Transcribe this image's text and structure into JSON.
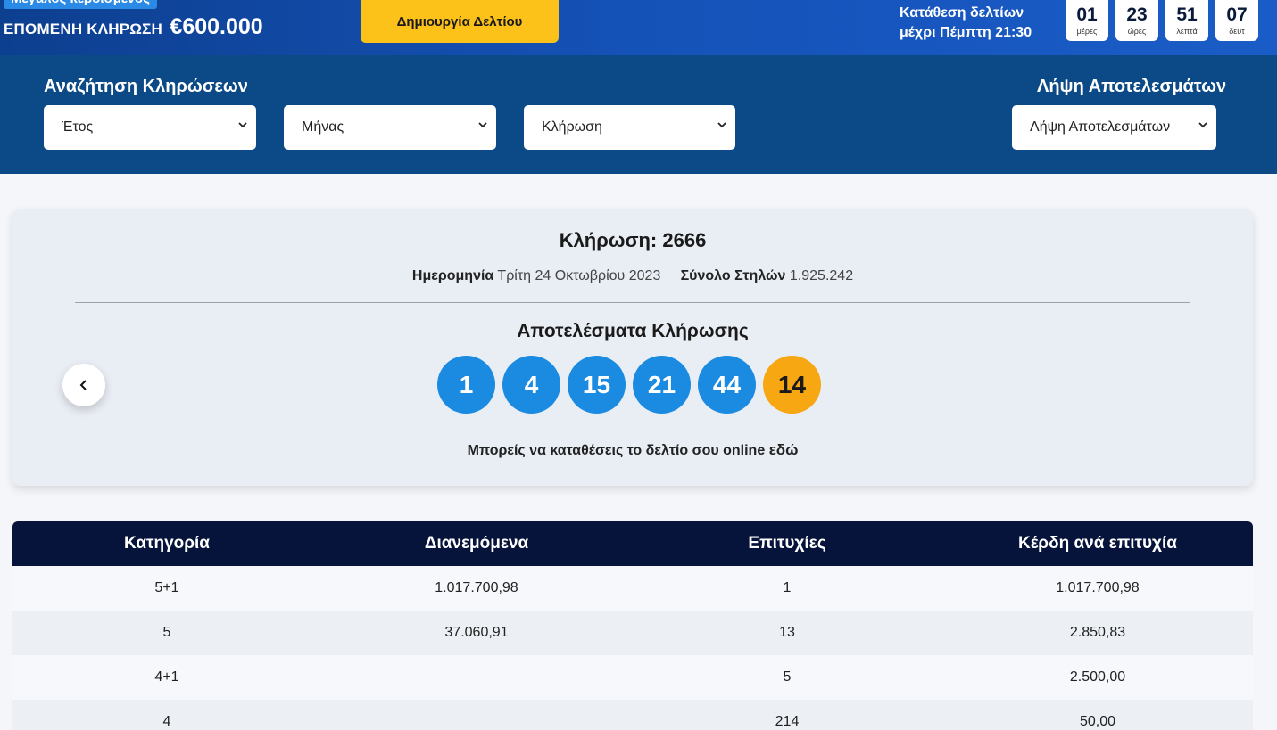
{
  "header": {
    "promo_tag": "Μεγάλος κερδισμένος",
    "next_draw_label": "ΕΠΟΜΕΝΗ ΚΛΗΡΩΣΗ",
    "next_draw_amount": "€600.000",
    "create_ticket_label": "Δημιουργία Δελτίου",
    "deadline_line1": "Κατάθεση δελτίων",
    "deadline_line2": "μέχρι Πέμπτη 21:30",
    "countdown": [
      {
        "value": "01",
        "unit": "μέρες"
      },
      {
        "value": "23",
        "unit": "ώρες"
      },
      {
        "value": "51",
        "unit": "λεπτά"
      },
      {
        "value": "07",
        "unit": "δευτ"
      }
    ]
  },
  "search": {
    "title": "Αναζήτηση Κληρώσεων",
    "year_select": "Έτος",
    "month_select": "Μήνας",
    "draw_select": "Κλήρωση",
    "download_title": "Λήψη Αποτελεσμάτων",
    "download_select": "Λήψη Αποτελεσμάτων"
  },
  "draw": {
    "title": "Κλήρωση: 2666",
    "date_label": "Ημερομηνία",
    "date_value": "Τρίτη 24 Οκτωβρίου 2023",
    "columns_label": "Σύνολο Στηλών",
    "columns_value": "1.925.242",
    "results_title": "Αποτελέσματα Κλήρωσης",
    "numbers": [
      "1",
      "4",
      "15",
      "21",
      "44"
    ],
    "bonus": "14",
    "online_note": "Μπορείς να καταθέσεις το δελτίο σου online",
    "online_link": "εδώ",
    "colors": {
      "ball": "#1a8be0",
      "bonus": "#f7a711"
    }
  },
  "table": {
    "headers": [
      "Κατηγορία",
      "Διανεμόμενα",
      "Επιτυχίες",
      "Κέρδη ανά επιτυχία"
    ],
    "rows": [
      [
        "5+1",
        "1.017.700,98",
        "1",
        "1.017.700,98"
      ],
      [
        "5",
        "37.060,91",
        "13",
        "2.850,83"
      ],
      [
        "4+1",
        "",
        "5",
        "2.500,00"
      ],
      [
        "4",
        "",
        "214",
        "50,00"
      ]
    ]
  }
}
